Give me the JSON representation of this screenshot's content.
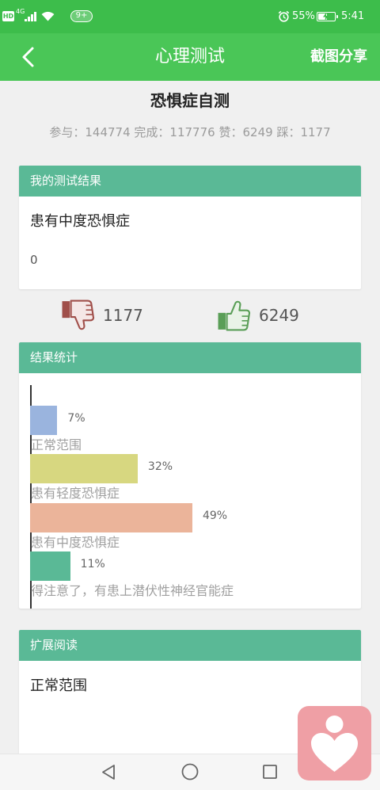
{
  "theme": {
    "status_bar": "#3dbd4b",
    "header": "#4ac657",
    "card_header": "#5ab996",
    "background": "#f0f0f0",
    "dislike": "#a04f4a",
    "like": "#5a9e57",
    "logo": "#ef9fa5"
  },
  "status_bar": {
    "hd_label": "HD",
    "network_label": "4G",
    "notification_badge": "9+",
    "battery_percent": "55%",
    "battery_level": 0.55,
    "time": "5:41",
    "icons": [
      "signal-icon",
      "wifi-icon",
      "alarm-icon",
      "battery-charging-icon"
    ]
  },
  "header": {
    "back_icon": "chevron-left-icon",
    "title": "心理测试",
    "share_label": "截图分享"
  },
  "test": {
    "title": "恐惧症自测",
    "stats": [
      {
        "label": "参与：",
        "value": "144774"
      },
      {
        "label": "完成：",
        "value": "117776"
      },
      {
        "label": "赞：",
        "value": "6249"
      },
      {
        "label": "踩：",
        "value": "1177"
      }
    ]
  },
  "result_card": {
    "header": "我的测试结果",
    "result": "患有中度恐惧症",
    "score": "0"
  },
  "votes": {
    "dislike_icon": "thumbs-down-icon",
    "dislike_count": "1177",
    "like_icon": "thumbs-up-icon",
    "like_count": "6249"
  },
  "stats_card": {
    "header": "结果统计"
  },
  "chart_data": {
    "type": "bar",
    "orientation": "horizontal",
    "categories": [
      "正常范围",
      "患有轻度恐惧症",
      "患有中度恐惧症",
      "得注意了，有患上潜伏性神经官能症"
    ],
    "values": [
      7,
      32,
      49,
      11
    ],
    "value_labels": [
      "7%",
      "32%",
      "49%",
      "11%"
    ],
    "colors": [
      "#9ab4de",
      "#d7d780",
      "#ebb49a",
      "#5ab996"
    ],
    "xlim": [
      0,
      100
    ],
    "grid": false
  },
  "reading_card": {
    "header": "扩展阅读",
    "content": "正常范围"
  },
  "nav_bar": {
    "icons": [
      "back-triangle-icon",
      "home-circle-icon",
      "recents-square-icon"
    ]
  },
  "floating_logo": {
    "icon": "heart-person-logo-icon"
  }
}
